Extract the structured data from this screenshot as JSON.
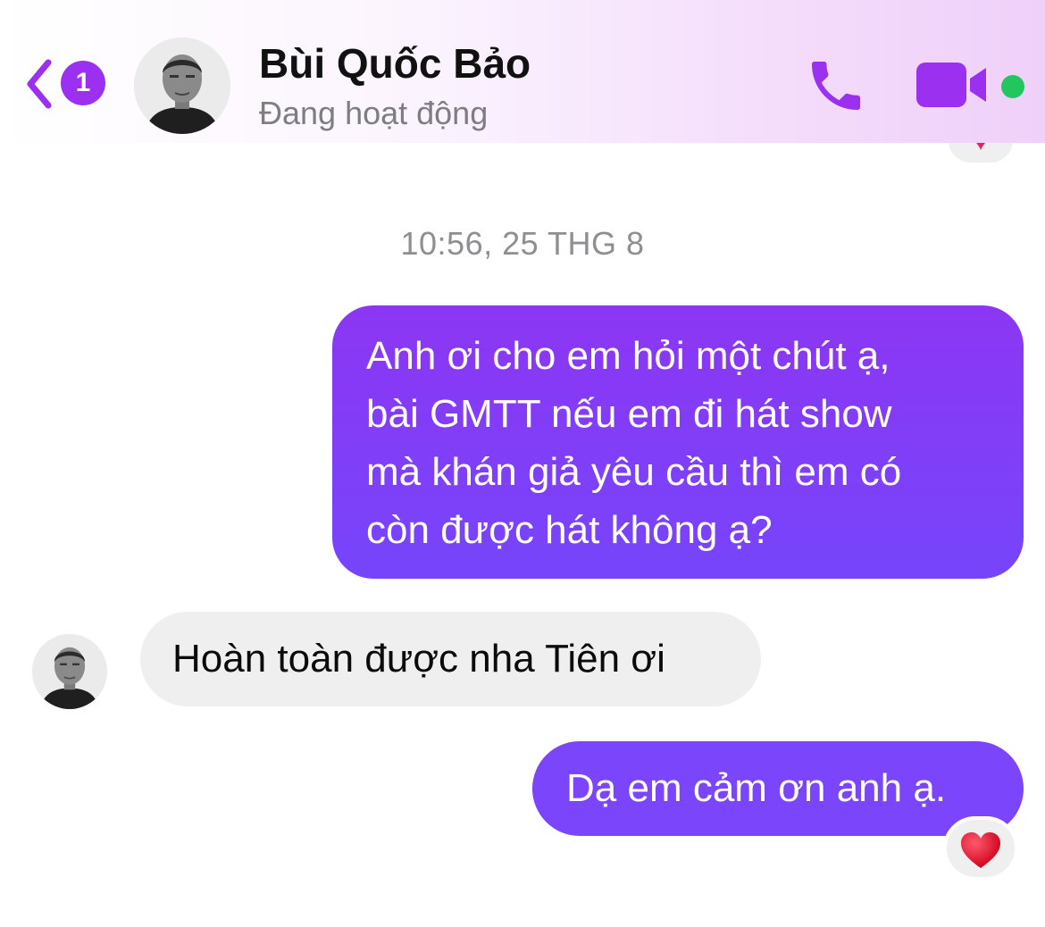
{
  "header": {
    "back_badge_count": "1",
    "contact_name": "Bùi Quốc Bảo",
    "status": "Đang hoạt động",
    "accent_color": "#9b30f0",
    "online_color": "#22c55e",
    "icons": {
      "back": "chevron-left-icon",
      "call": "phone-icon",
      "video": "video-camera-icon"
    }
  },
  "conversation": {
    "timestamp": "10:56, 25 THG 8",
    "messages": [
      {
        "direction": "outgoing",
        "lines": [
          "Anh ơi cho em hỏi một chút ạ,",
          "bài GMTT nếu em đi hát show",
          "mà khán giả yêu cầu thì em có",
          "còn được hát không ạ?"
        ]
      },
      {
        "direction": "incoming",
        "text": "Hoàn toàn được nha Tiên ơi"
      },
      {
        "direction": "outgoing",
        "text": "Dạ em cảm ơn anh ạ.",
        "reaction": "heart"
      }
    ]
  }
}
